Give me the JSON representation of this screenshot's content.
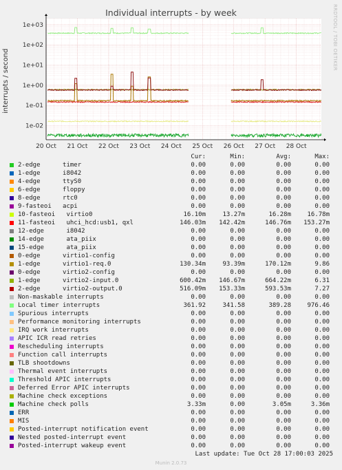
{
  "title": "Individual interrupts - by week",
  "side_label": "RRDTOOL / TOBI OETIKER",
  "chart_data": {
    "type": "line",
    "title": "Individual interrupts - by week",
    "ylabel": "interrupts / second",
    "yscale": "log",
    "ylim": [
      0.002,
      2000
    ],
    "yticks": [
      "1e-02",
      "1e-01",
      "1e+00",
      "1e+01",
      "1e+02",
      "1e+03"
    ],
    "xticks": [
      "20 Oct",
      "21 Oct",
      "22 Oct",
      "23 Oct",
      "24 Oct",
      "25 Oct",
      "26 Oct",
      "27 Oct",
      "28 Oct"
    ],
    "grid": true,
    "gap": [
      "24 Oct 12:00",
      "25 Oct 22:00"
    ],
    "series": [
      {
        "name": "Local timer interrupts",
        "color": "#99ee88",
        "base": 380,
        "peaks": [
          720,
          650,
          700,
          600,
          700
        ]
      },
      {
        "name": "10-fasteoi virtio0",
        "color": "#e8ea88",
        "base": 0.0163
      },
      {
        "name": "11-fasteoi uhci_hcd:usb1, qxl",
        "color": "#e0262a",
        "base": 0.147
      },
      {
        "name": "1-edge virtio1-req.0",
        "color": "#aa7700",
        "base": 0.17,
        "peaks": [
          1.2,
          3.5,
          0.9,
          2.6
        ]
      },
      {
        "name": "1-edge virtio2-input.0",
        "color": "#97a41f",
        "base": 0.6
      },
      {
        "name": "2-edge virtio2-output.0",
        "color": "#8f1515",
        "base": 0.58,
        "peaks": [
          2.2,
          0.9,
          4.5,
          2.3,
          1.9
        ]
      },
      {
        "name": "Machine check polls",
        "color": "#1faa33",
        "base": 0.0033
      }
    ]
  },
  "legend": {
    "header": {
      "cur": "Cur:",
      "min": "Min:",
      "avg": "Avg:",
      "max": "Max:"
    },
    "rows": [
      {
        "label": "2-edge      timer",
        "color": "#22cc22",
        "cur": "0.00",
        "min": "0.00",
        "avg": "0.00",
        "max": "0.00"
      },
      {
        "label": "1-edge      i8042",
        "color": "#0066bb",
        "cur": "0.00",
        "min": "0.00",
        "avg": "0.00",
        "max": "0.00"
      },
      {
        "label": "4-edge      ttyS0",
        "color": "#ff8800",
        "cur": "0.00",
        "min": "0.00",
        "avg": "0.00",
        "max": "0.00"
      },
      {
        "label": "6-edge      floppy",
        "color": "#ffcc00",
        "cur": "0.00",
        "min": "0.00",
        "avg": "0.00",
        "max": "0.00"
      },
      {
        "label": "8-edge      rtc0",
        "color": "#330099",
        "cur": "0.00",
        "min": "0.00",
        "avg": "0.00",
        "max": "0.00"
      },
      {
        "label": "9-fasteoi   acpi",
        "color": "#990099",
        "cur": "0.00",
        "min": "0.00",
        "avg": "0.00",
        "max": "0.00"
      },
      {
        "label": "10-fasteoi   virtio0",
        "color": "#ccff00",
        "cur": "16.10m",
        "min": "13.27m",
        "avg": "16.28m",
        "max": "16.78m"
      },
      {
        "label": "11-fasteoi   uhci_hcd:usb1, qxl",
        "color": "#ff0000",
        "cur": "146.03m",
        "min": "142.42m",
        "avg": "146.76m",
        "max": "153.27m"
      },
      {
        "label": "12-edge      i8042",
        "color": "#808080",
        "cur": "0.00",
        "min": "0.00",
        "avg": "0.00",
        "max": "0.00"
      },
      {
        "label": "14-edge      ata_piix",
        "color": "#008f00",
        "cur": "0.00",
        "min": "0.00",
        "avg": "0.00",
        "max": "0.00"
      },
      {
        "label": "15-edge      ata_piix",
        "color": "#00487d",
        "cur": "0.00",
        "min": "0.00",
        "avg": "0.00",
        "max": "0.00"
      },
      {
        "label": "0-edge      virtio1-config",
        "color": "#b35a00",
        "cur": "0.00",
        "min": "0.00",
        "avg": "0.00",
        "max": "0.00"
      },
      {
        "label": "1-edge      virtio1-req.0",
        "color": "#b38f00",
        "cur": "130.34m",
        "min": "93.39m",
        "avg": "170.12m",
        "max": "9.86"
      },
      {
        "label": "0-edge      virtio2-config",
        "color": "#6b006b",
        "cur": "0.00",
        "min": "0.00",
        "avg": "0.00",
        "max": "0.00"
      },
      {
        "label": "1-edge      virtio2-input.0",
        "color": "#8fb300",
        "cur": "600.42m",
        "min": "146.67m",
        "avg": "664.22m",
        "max": "6.31"
      },
      {
        "label": "2-edge      virtio2-output.0",
        "color": "#b30000",
        "cur": "516.09m",
        "min": "153.33m",
        "avg": "593.53m",
        "max": "7.27"
      },
      {
        "label": "Non-maskable interrupts",
        "color": "#bebebe",
        "cur": "0.00",
        "min": "0.00",
        "avg": "0.00",
        "max": "0.00"
      },
      {
        "label": "Local timer interrupts",
        "color": "#80ff80",
        "cur": "361.92",
        "min": "341.58",
        "avg": "389.28",
        "max": "976.46"
      },
      {
        "label": "Spurious interrupts",
        "color": "#80c9ff",
        "cur": "0.00",
        "min": "0.00",
        "avg": "0.00",
        "max": "0.00"
      },
      {
        "label": "Performance monitoring interrupts",
        "color": "#ffc080",
        "cur": "0.00",
        "min": "0.00",
        "avg": "0.00",
        "max": "0.00"
      },
      {
        "label": "IRQ work interrupts",
        "color": "#ffe680",
        "cur": "0.00",
        "min": "0.00",
        "avg": "0.00",
        "max": "0.00"
      },
      {
        "label": "APIC ICR read retries",
        "color": "#aa80ff",
        "cur": "0.00",
        "min": "0.00",
        "avg": "0.00",
        "max": "0.00"
      },
      {
        "label": "Rescheduling interrupts",
        "color": "#ee00cc",
        "cur": "0.00",
        "min": "0.00",
        "avg": "0.00",
        "max": "0.00"
      },
      {
        "label": "Function call interrupts",
        "color": "#ff8080",
        "cur": "0.00",
        "min": "0.00",
        "avg": "0.00",
        "max": "0.00"
      },
      {
        "label": "TLB shootdowns",
        "color": "#666600",
        "cur": "0.00",
        "min": "0.00",
        "avg": "0.00",
        "max": "0.00"
      },
      {
        "label": "Thermal event interrupts",
        "color": "#ffbfff",
        "cur": "0.00",
        "min": "0.00",
        "avg": "0.00",
        "max": "0.00"
      },
      {
        "label": "Threshold APIC interrupts",
        "color": "#00ffcc",
        "cur": "0.00",
        "min": "0.00",
        "avg": "0.00",
        "max": "0.00"
      },
      {
        "label": "Deferred Error APIC interrupts",
        "color": "#cc6699",
        "cur": "0.00",
        "min": "0.00",
        "avg": "0.00",
        "max": "0.00"
      },
      {
        "label": "Machine check exceptions",
        "color": "#aab000",
        "cur": "0.00",
        "min": "0.00",
        "avg": "0.00",
        "max": "0.00"
      },
      {
        "label": "Machine check polls",
        "color": "#00cc00",
        "cur": "3.33m",
        "min": "0.00",
        "avg": "3.05m",
        "max": "3.36m"
      },
      {
        "label": "ERR",
        "color": "#0066b3",
        "cur": "0.00",
        "min": "0.00",
        "avg": "0.00",
        "max": "0.00"
      },
      {
        "label": "MIS",
        "color": "#ff8000",
        "cur": "0.00",
        "min": "0.00",
        "avg": "0.00",
        "max": "0.00"
      },
      {
        "label": "Posted-interrupt notification event",
        "color": "#ffcc00",
        "cur": "0.00",
        "min": "0.00",
        "avg": "0.00",
        "max": "0.00"
      },
      {
        "label": "Nested posted-interrupt event",
        "color": "#330099",
        "cur": "0.00",
        "min": "0.00",
        "avg": "0.00",
        "max": "0.00"
      },
      {
        "label": "Posted-interrupt wakeup event",
        "color": "#990099",
        "cur": "0.00",
        "min": "0.00",
        "avg": "0.00",
        "max": "0.00"
      }
    ]
  },
  "footer": {
    "last_update": "Last update: Tue Oct 28 17:00:03 2025",
    "munin": "Munin 2.0.73"
  }
}
